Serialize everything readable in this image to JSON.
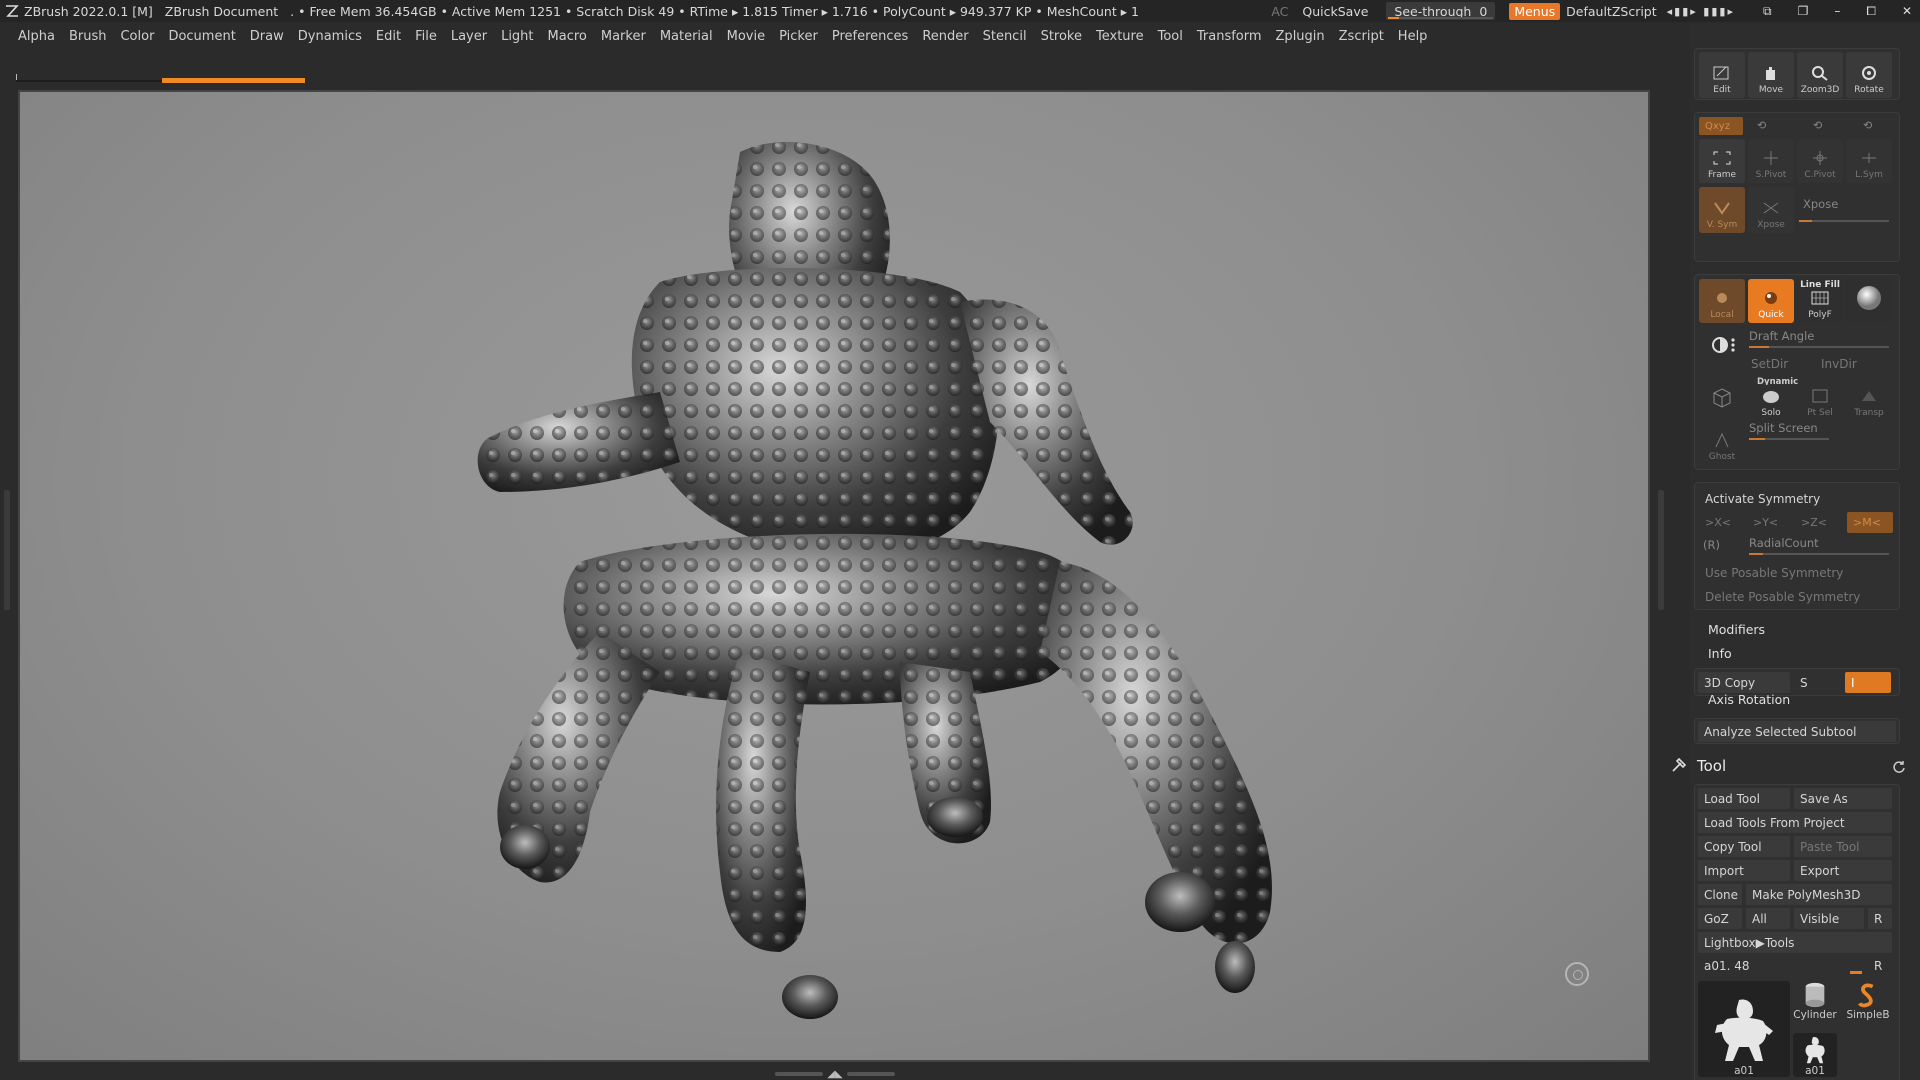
{
  "titlebar": {
    "app_title": "ZBrush 2022.0.1 [M]",
    "document": "ZBrush Document",
    "stats": ". • Free Mem 36.454GB • Active Mem 1251 • Scratch Disk 49 • RTime ▸ 1.815 Timer ▸ 1.716 • PolyCount ▸ 949.377 KP • MeshCount ▸ 1",
    "ac": "AC",
    "quicksave": "QuickSave",
    "see_through_label": "See-through",
    "see_through_value": "0",
    "menus": "Menus",
    "script": "DefaultZScript"
  },
  "menubar": {
    "items": [
      "Alpha",
      "Brush",
      "Color",
      "Document",
      "Draw",
      "Dynamics",
      "Edit",
      "File",
      "Layer",
      "Light",
      "Macro",
      "Marker",
      "Material",
      "Movie",
      "Picker",
      "Preferences",
      "Render",
      "Stencil",
      "Stroke",
      "Texture",
      "Tool",
      "Transform",
      "Zplugin",
      "Zscript",
      "Help"
    ]
  },
  "right_panel": {
    "nav": {
      "edit": "Edit",
      "move": "Move",
      "zoom3d": "Zoom3D",
      "rotate": "Rotate"
    },
    "axis_row": {
      "xyz": "Qxyz"
    },
    "frame_row": {
      "frame": "Frame",
      "spivot": "S.Pivot",
      "cpivot": "C.Pivot",
      "lsym": "L.Sym"
    },
    "xpose_row": {
      "vsym": "V. Sym",
      "xpose_btn": "Xpose",
      "xpose_label": "Xpose"
    },
    "draw_row": {
      "local": "Local",
      "quick": "Quick",
      "line_fill": "Line Fill",
      "polyf": "PolyF"
    },
    "draft_angle": "Draft Angle",
    "setdir": "SetDir",
    "invdir": "InvDir",
    "dynamic": "Dynamic",
    "solo": "Solo",
    "ptsel": "Pt Sel",
    "transp": "Transp",
    "split_screen": "Split Screen",
    "ghost": "Ghost",
    "symmetry": {
      "activate": "Activate Symmetry",
      "x": ">X<",
      "y": ">Y<",
      "z": ">Z<",
      "m": ">M<",
      "r": "(R)",
      "radial_count": "RadialCount",
      "use_posable": "Use Posable Symmetry",
      "delete_posable": "Delete Posable Symmetry"
    },
    "modifiers": "Modifiers",
    "info": "Info",
    "copy3d": "3D Copy",
    "copy_s": "S",
    "copy_i": "I",
    "axis_rotation": "Axis Rotation",
    "analyze": "Analyze Selected Subtool",
    "tool": {
      "title": "Tool",
      "load_tool": "Load Tool",
      "save_as": "Save As",
      "load_from_project": "Load Tools From Project",
      "copy_tool": "Copy Tool",
      "paste_tool": "Paste Tool",
      "import": "Import",
      "export": "Export",
      "clone": "Clone",
      "make_polymesh": "Make PolyMesh3D",
      "goz": "GoZ",
      "all": "All",
      "visible": "Visible",
      "r": "R",
      "lightbox_tools": "Lightbox▶Tools",
      "current_tool": "a01. 48",
      "thumbs": [
        "a01",
        "Cylinder",
        "SimpleB",
        "a01"
      ]
    }
  }
}
